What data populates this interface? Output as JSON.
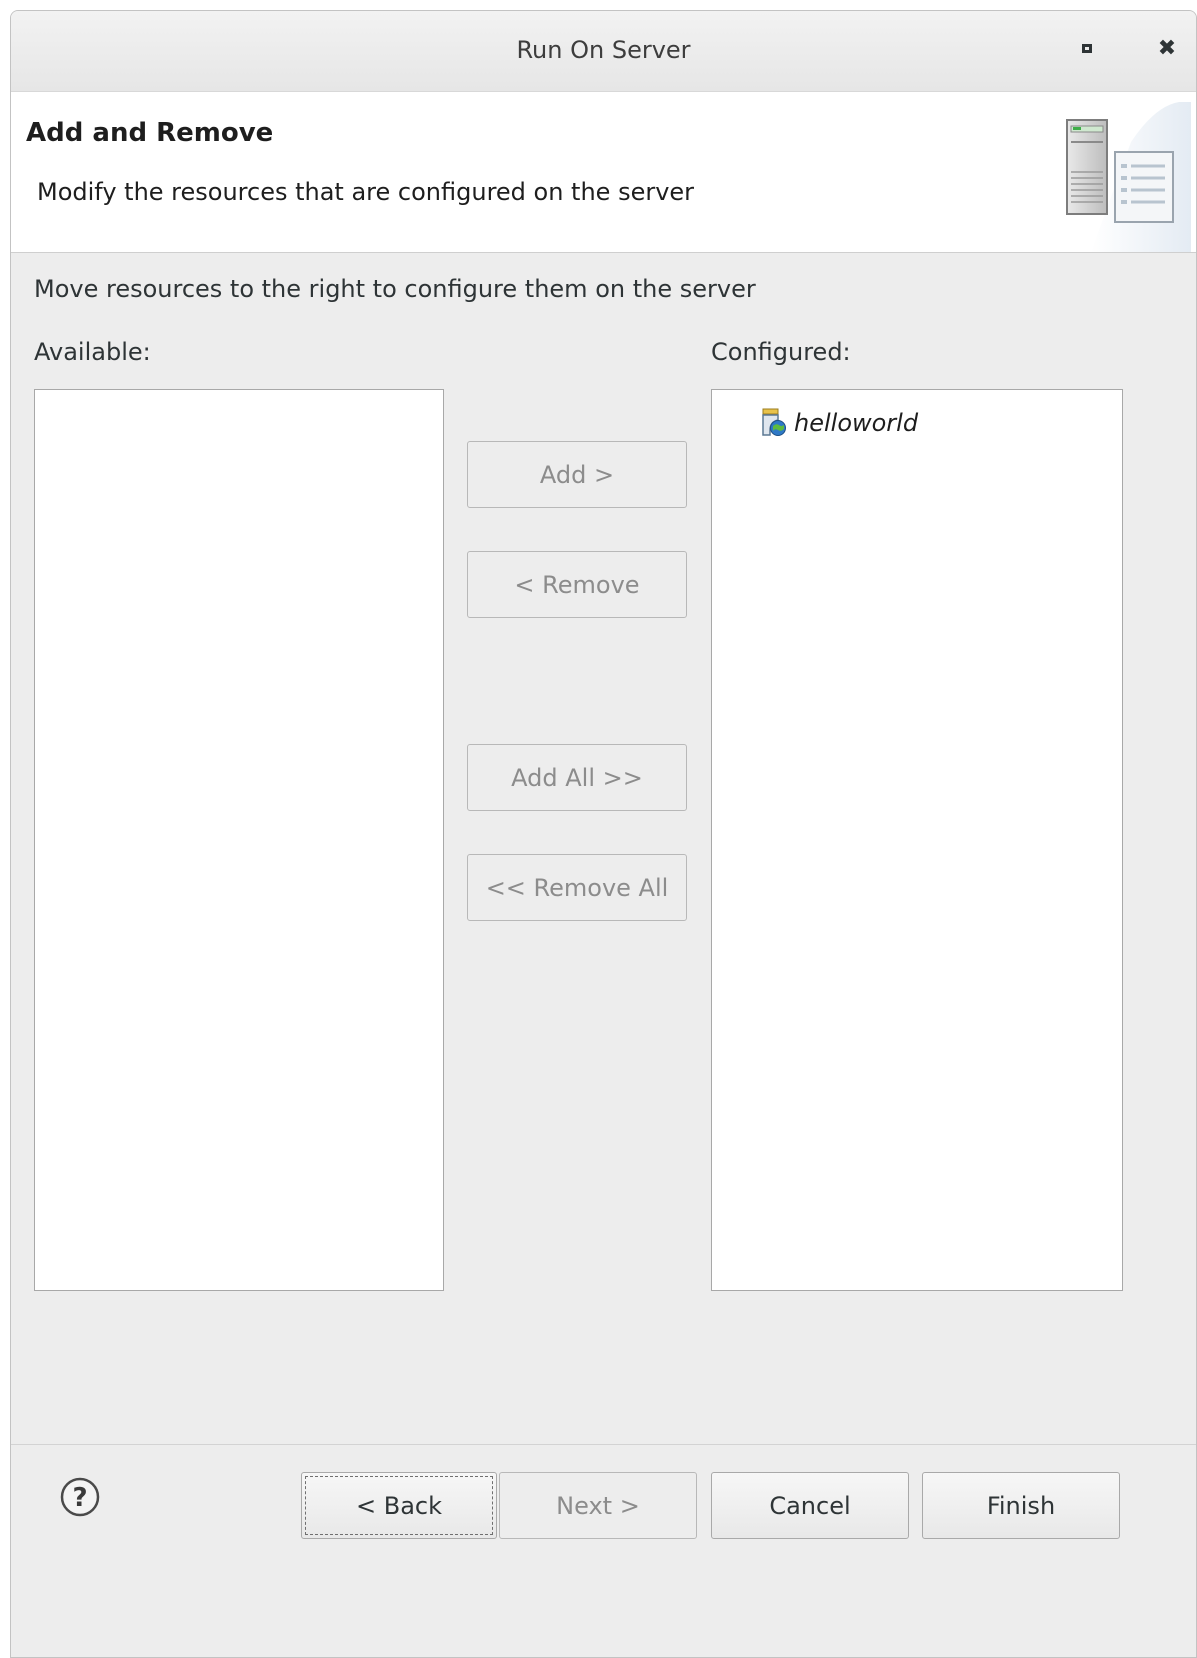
{
  "window": {
    "title": "Run On Server",
    "maximize_icon": "maximize-icon",
    "close_icon": "close-icon",
    "close_glyph": "✖"
  },
  "header": {
    "title": "Add and Remove",
    "description": "Modify the resources that are configured on the server",
    "banner_icon": "server-wizard-banner-icon"
  },
  "main": {
    "instruction": "Move resources to the right to configure them on the server",
    "available_label": "Available:",
    "configured_label": "Configured:",
    "available_items": [],
    "configured_items": [
      {
        "label": "helloworld",
        "icon": "web-project-icon"
      }
    ],
    "buttons": {
      "add": "Add >",
      "remove": "< Remove",
      "add_all": "Add All >>",
      "remove_all": "<< Remove All"
    }
  },
  "footer": {
    "help_icon": "help-icon",
    "back": "< Back",
    "next": "Next >",
    "cancel": "Cancel",
    "finish": "Finish"
  },
  "colors": {
    "dialog_background": "#ededed",
    "header_background": "#ffffff",
    "disabled_text": "#8c8c8c",
    "text": "#2e3436"
  }
}
